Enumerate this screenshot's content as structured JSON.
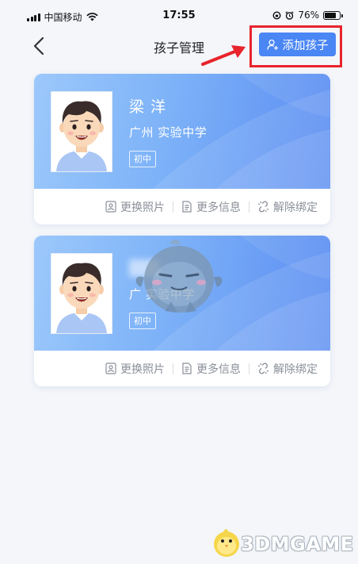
{
  "status_bar": {
    "carrier": "中国移动",
    "time": "17:55",
    "battery": "76%",
    "battery_level": 0.76
  },
  "nav": {
    "title": "孩子管理",
    "add_button": "添加孩子"
  },
  "children": [
    {
      "name": "梁 洋",
      "school": "广州 实验中学",
      "grade": "初中"
    },
    {
      "name": "",
      "school": "广 实验中学",
      "grade": "初中"
    }
  ],
  "actions": {
    "change_photo": "更换照片",
    "more_info": "更多信息",
    "unbind": "解除绑定"
  },
  "watermark": {
    "logo_text": "3DMGAME"
  },
  "colors": {
    "accent": "#4a86f4",
    "highlight": "#e8242c",
    "card_gradient_start": "#9cc8fb",
    "card_gradient_end": "#5a8cf1"
  }
}
